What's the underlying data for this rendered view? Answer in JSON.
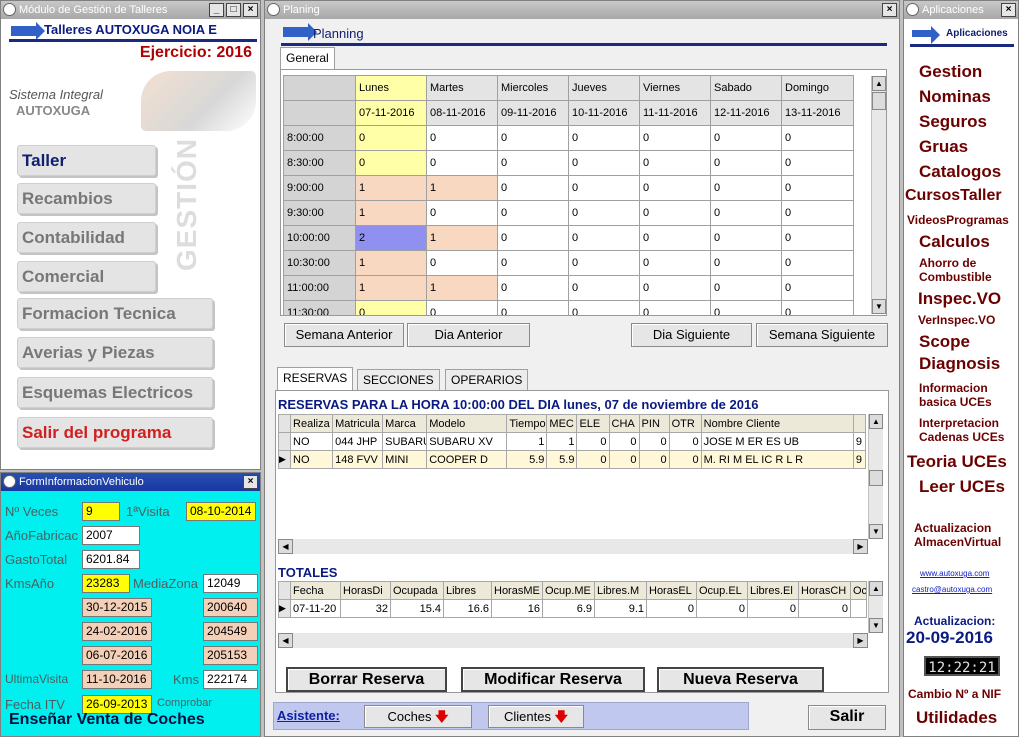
{
  "left": {
    "title": "Módulo de Gestión de Talleres",
    "header": "Talleres AUTOXUGA NOIA E",
    "year": "Ejercicio: 2016",
    "logo_line1": "Sistema Integral",
    "logo_line2": "AUTOXUGA",
    "side_label": "GESTIÓN",
    "nav": [
      "Taller",
      "Recambios",
      "Contabilidad",
      "Comercial",
      "Formacion Tecnica",
      "Averias y Piezas",
      "Esquemas Electricos",
      "Salir del programa"
    ]
  },
  "vehicle": {
    "title": "FormInformacionVehiculo",
    "nveces_label": "Nº Veces",
    "nveces": "9",
    "visita_label": "1ªVisita",
    "visita": "08-10-2014",
    "anio_label": "AñoFabricac",
    "anio": "2007",
    "gasto_label": "GastoTotal",
    "gasto": "6201.84",
    "kms_label": "KmsAño",
    "kms": "23283",
    "media_label": "MediaZona",
    "media": "12049",
    "dates": [
      "30-12-2015",
      "24-02-2016",
      "06-07-2016"
    ],
    "kmvals": [
      "200640",
      "204549",
      "205153"
    ],
    "ultima_label": "UltimaVisita",
    "ultima": "11-10-2016",
    "kms2_label": "Kms",
    "kms2": "222174",
    "itv_label": "Fecha ITV",
    "itv": "26-09-2013",
    "comprobar": "Comprobar",
    "sell": "Enseñar Venta de Coches"
  },
  "planning": {
    "title": "Planing",
    "header": "Planning",
    "tab_general": "General",
    "days": [
      "Lunes",
      "Martes",
      "Miercoles",
      "Jueves",
      "Viernes",
      "Sabado",
      "Domingo"
    ],
    "dates": [
      "07-11-2016",
      "08-11-2016",
      "09-11-2016",
      "10-11-2016",
      "11-11-2016",
      "12-11-2016",
      "13-11-2016"
    ],
    "rows": [
      {
        "time": "8:00:00",
        "v": [
          "0",
          "0",
          "0",
          "0",
          "0",
          "0",
          "0"
        ]
      },
      {
        "time": "8:30:00",
        "v": [
          "0",
          "0",
          "0",
          "0",
          "0",
          "0",
          "0"
        ]
      },
      {
        "time": "9:00:00",
        "v": [
          "1",
          "1",
          "0",
          "0",
          "0",
          "0",
          "0"
        ]
      },
      {
        "time": "9:30:00",
        "v": [
          "1",
          "0",
          "0",
          "0",
          "0",
          "0",
          "0"
        ]
      },
      {
        "time": "10:00:00",
        "v": [
          "2",
          "1",
          "0",
          "0",
          "0",
          "0",
          "0"
        ]
      },
      {
        "time": "10:30:00",
        "v": [
          "1",
          "0",
          "0",
          "0",
          "0",
          "0",
          "0"
        ]
      },
      {
        "time": "11:00:00",
        "v": [
          "1",
          "1",
          "0",
          "0",
          "0",
          "0",
          "0"
        ]
      },
      {
        "time": "11:30:00",
        "v": [
          "0",
          "0",
          "0",
          "0",
          "0",
          "0",
          "0"
        ]
      }
    ],
    "btn_semana_ant": "Semana Anterior",
    "btn_dia_ant": "Dia Anterior",
    "btn_dia_sig": "Dia Siguiente",
    "btn_semana_sig": "Semana Siguiente",
    "tabs": [
      "RESERVAS",
      "SECCIONES",
      "OPERARIOS"
    ],
    "res_title": "RESERVAS PARA LA HORA 10:00:00 DEL DIA lunes, 07 de noviembre de 2016",
    "res_cols": [
      "Realiza",
      "Matricula",
      "Marca",
      "Modelo",
      "Tiempo",
      "MEC",
      "ELE",
      "CHA",
      "PIN",
      "OTR",
      "Nombre Cliente",
      ""
    ],
    "res_rows": [
      [
        "NO",
        "044 JHP",
        "SUBARU",
        "SUBARU XV",
        "1",
        "1",
        "0",
        "0",
        "0",
        "0",
        "JOSE  M  ER  ES  UB",
        "9"
      ],
      [
        "NO",
        "148 FVV",
        "MINI",
        "COOPER D",
        "5.9",
        "5.9",
        "0",
        "0",
        "0",
        "0",
        "M. RI  M  EL IC  R L  R",
        "9"
      ]
    ],
    "totales": "TOTALES",
    "tot_cols": [
      "Fecha",
      "HorasDi",
      "Ocupada",
      "Libres",
      "HorasME",
      "Ocup.ME",
      "Libres.M",
      "HorasEL",
      "Ocup.EL",
      "Libres.El",
      "HorasCH",
      "Oc"
    ],
    "tot_row": [
      "07-11-20",
      "32",
      "15.4",
      "16.6",
      "16",
      "6.9",
      "9.1",
      "0",
      "0",
      "0",
      "0",
      ""
    ],
    "btn_borrar": "Borrar Reserva",
    "btn_modificar": "Modificar Reserva",
    "btn_nueva": "Nueva Reserva",
    "asistente": "Asistente:",
    "coches": "Coches",
    "clientes": "Clientes",
    "salir": "Salir"
  },
  "apps": {
    "title": "Aplicaciones",
    "header": "Aplicaciones",
    "items": [
      "Gestion",
      "Nominas",
      "Seguros",
      "Gruas",
      "Catalogos",
      "CursosTaller",
      "VideosProgramas",
      "Calculos",
      "Ahorro de",
      "Combustible",
      "Inspec.VO",
      "VerInspec.VO",
      "Scope",
      "Diagnosis",
      "Informacion",
      "basica UCEs",
      "Interpretacion",
      "Cadenas UCEs",
      "Teoria UCEs",
      "Leer UCEs",
      "Actualizacion",
      "AlmacenVirtual"
    ],
    "web": "www.autoxuga.com",
    "email": "castro@autoxuga.com",
    "upd_label": "Actualizacion:",
    "upd_date": "20-09-2016",
    "clock": "12:22:21",
    "cambio": "Cambio Nº a NIF",
    "utilidades": "Utilidades"
  }
}
